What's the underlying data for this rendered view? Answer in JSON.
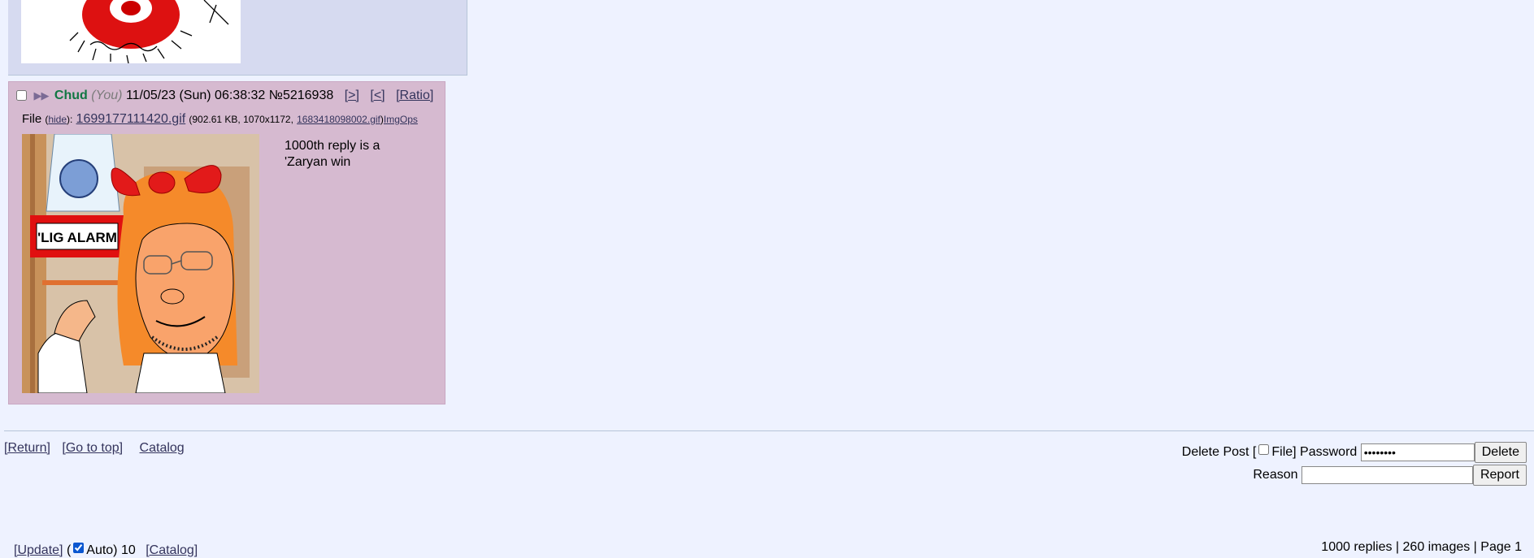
{
  "previous_post": {},
  "post": {
    "arrows": "▶▶",
    "name": "Chud",
    "you_tag": "(You)",
    "datetime": "11/05/23 (Sun) 06:38:32",
    "post_number": "№5216938",
    "nav_links": [
      "[>]",
      "[<]",
      "[Ratio]"
    ],
    "file_label": "File",
    "hide_label": "hide",
    "file_name": "1699177111420.gif",
    "file_info": "(902.61 KB, 1070x1172,",
    "orig_name": "1683418098002.gif",
    "imgops": "ImgOps",
    "comment_lines": [
      "1000th reply is a",
      "'Zaryan win"
    ],
    "thumb_sign_text": "'LIG ALARM"
  },
  "footer": {
    "return": "[Return]",
    "go_top": "[Go to top]",
    "catalog": "Catalog",
    "delete_post": "Delete Post [",
    "file": "File] Password",
    "password_value": "••••••••",
    "delete_btn": "Delete",
    "reason": "Reason",
    "report_btn": "Report",
    "update": "[Update]",
    "auto_open": "(",
    "auto": "Auto) 10",
    "catalog2": "[Catalog]",
    "stats": "1000 replies | 260 images | Page 1"
  },
  "colors": {
    "post_bg": "#d6bad0",
    "prev_bg": "#d6daf0",
    "page_bg": "#eef2ff",
    "name": "#117743"
  }
}
